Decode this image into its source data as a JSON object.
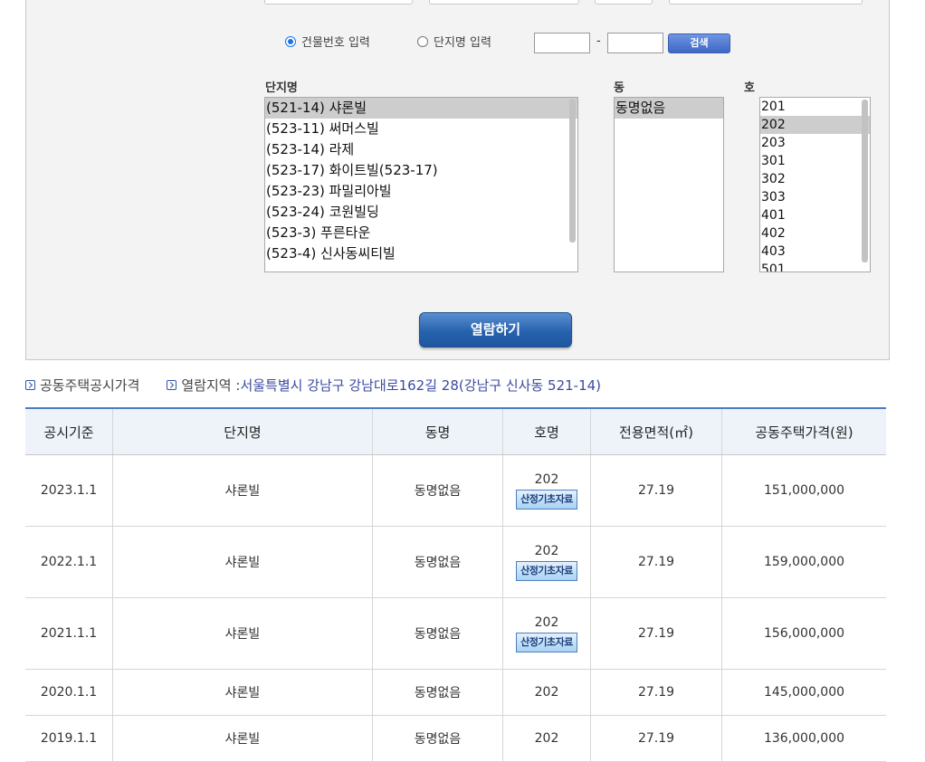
{
  "search": {
    "radio_building_no": "건물번호 입력",
    "radio_complex_name": "단지명 입력",
    "search_button": "검색"
  },
  "lists": {
    "complex_label": "단지명",
    "dong_label": "동",
    "ho_label": "호",
    "complex_items": [
      "(521-14) 샤론빌",
      "(523-11) 써머스빌",
      "(523-14) 라제",
      "(523-17) 화이트빌(523-17)",
      "(523-23) 파밀리아빌",
      "(523-24) 코원빌딩",
      "(523-3) 푸른타운",
      "(523-4) 신사동씨티빌"
    ],
    "dong_items": [
      "동명없음"
    ],
    "ho_items": [
      "201",
      "202",
      "203",
      "301",
      "302",
      "303",
      "401",
      "402",
      "403",
      "501"
    ]
  },
  "view_button": "열람하기",
  "info": {
    "section_title": "공동주택공시가격",
    "region_label": "열람지역 : ",
    "region_address": "서울특별시 강남구 강남대로162길 28(강남구 신사동 521-14)"
  },
  "table": {
    "headers": [
      "공시기준",
      "단지명",
      "동명",
      "호명",
      "전용면적(㎡)",
      "공동주택가격(원)"
    ],
    "calc_button": "산정기초자료",
    "rows": [
      {
        "date": "2023.1.1",
        "complex": "샤론빌",
        "dong": "동명없음",
        "ho": "202",
        "area": "27.19",
        "price": "151,000,000"
      },
      {
        "date": "2022.1.1",
        "complex": "샤론빌",
        "dong": "동명없음",
        "ho": "202",
        "area": "27.19",
        "price": "159,000,000"
      },
      {
        "date": "2021.1.1",
        "complex": "샤론빌",
        "dong": "동명없음",
        "ho": "202",
        "area": "27.19",
        "price": "156,000,000"
      },
      {
        "date": "2020.1.1",
        "complex": "샤론빌",
        "dong": "동명없음",
        "ho": "202",
        "area": "27.19",
        "price": "145,000,000"
      },
      {
        "date": "2019.1.1",
        "complex": "샤론빌",
        "dong": "동명없음",
        "ho": "202",
        "area": "27.19",
        "price": "136,000,000"
      }
    ]
  }
}
